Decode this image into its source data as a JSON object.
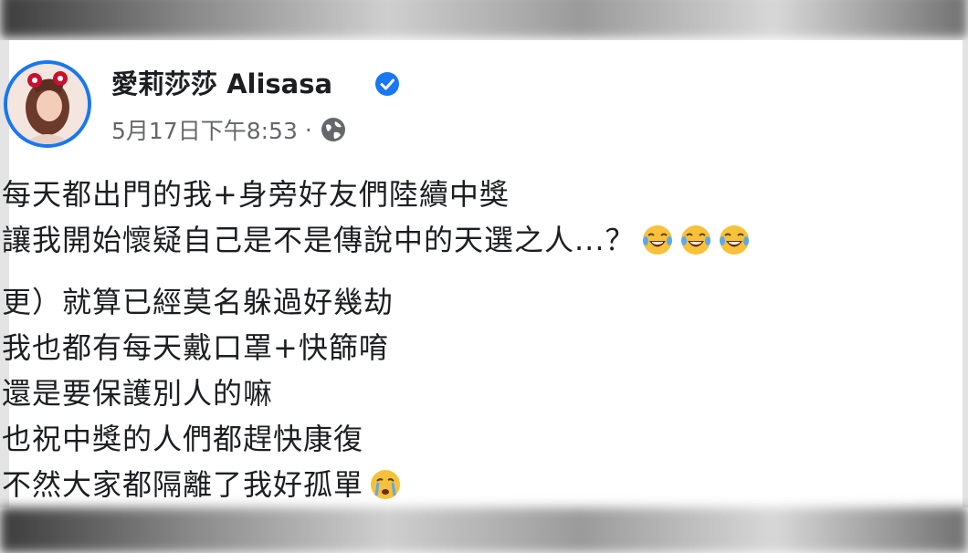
{
  "post": {
    "author_name": "愛莉莎莎 Alisasa",
    "timestamp": "5月17日下午8:53",
    "meta_separator": "·",
    "verified_icon": "verified-badge-icon",
    "privacy_icon": "globe-icon",
    "paragraphs": [
      {
        "lines": [
          {
            "text": "每天都出門的我+身旁好友們陸續中獎"
          },
          {
            "text": "讓我開始懷疑自己是不是傳說中的天選之人...？",
            "emoji": [
              "tears-of-joy-emoji",
              "tears-of-joy-emoji",
              "tears-of-joy-emoji"
            ]
          }
        ]
      },
      {
        "lines": [
          {
            "text": "更）就算已經莫名躲過好幾劫"
          },
          {
            "text": "我也都有每天戴口罩+快篩唷"
          },
          {
            "text": "還是要保護別人的嘛"
          },
          {
            "text": "也祝中獎的人們都趕快康復"
          },
          {
            "text": "不然大家都隔離了我好孤單",
            "emoji": [
              "crying-emoji"
            ]
          }
        ]
      }
    ]
  },
  "colors": {
    "name_text": "#1c1e21",
    "meta_text": "#65676b",
    "verified_blue": "#1877f2",
    "emoji_yellow": "#f7c23a"
  }
}
